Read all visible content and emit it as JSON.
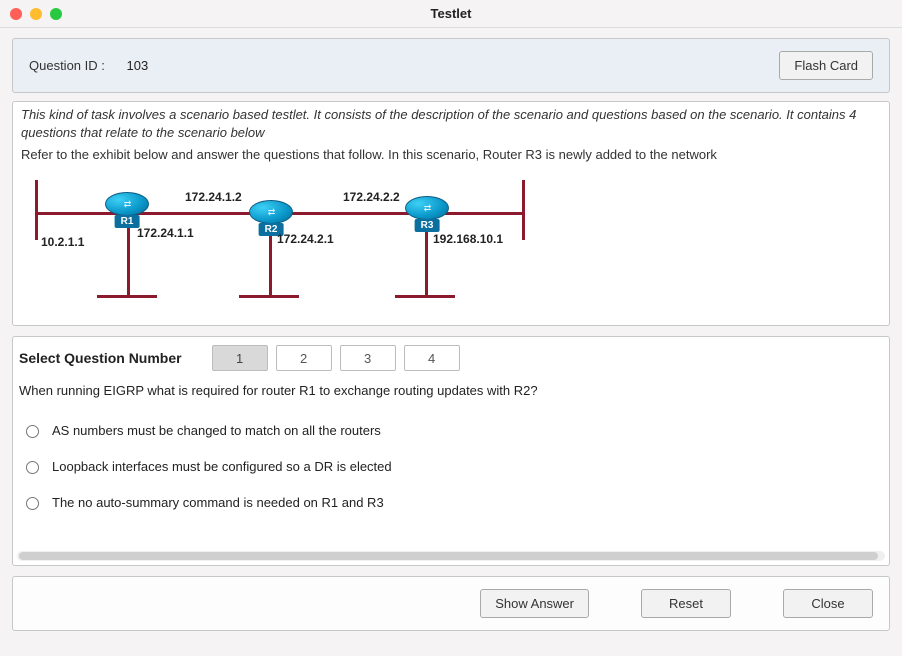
{
  "window": {
    "title": "Testlet"
  },
  "header": {
    "qid_label": "Question ID :",
    "qid_value": "103",
    "flash_card_label": "Flash Card"
  },
  "scenario": {
    "intro": "This kind of task involves a scenario based testlet. It consists of the description of the scenario and questions based on the scenario. It contains 4 questions that relate to the scenario below",
    "instruction": "Refer to the exhibit below and answer the questions that follow. In this scenario, Router R3 is newly added to the network",
    "diagram": {
      "routers": [
        {
          "name": "R1"
        },
        {
          "name": "R2"
        },
        {
          "name": "R3"
        }
      ],
      "ip_labels": {
        "r1_left": "10.2.1.1",
        "r1_right": "172.24.1.1",
        "r2_left": "172.24.1.2",
        "r2_right": "172.24.2.1",
        "r3_left": "172.24.2.2",
        "r3_right": "192.168.10.1"
      }
    }
  },
  "question_area": {
    "select_label": "Select Question Number",
    "tabs": [
      "1",
      "2",
      "3",
      "4"
    ],
    "active_tab": 0,
    "question_text": "When running EIGRP what is required for router R1 to exchange routing updates with R2?",
    "options": [
      "AS numbers must be changed to match on all the routers",
      "Loopback interfaces must be configured so a DR is elected",
      "The no auto-summary command is needed on R1 and R3"
    ]
  },
  "footer": {
    "show_answer": "Show Answer",
    "reset": "Reset",
    "close": "Close"
  }
}
